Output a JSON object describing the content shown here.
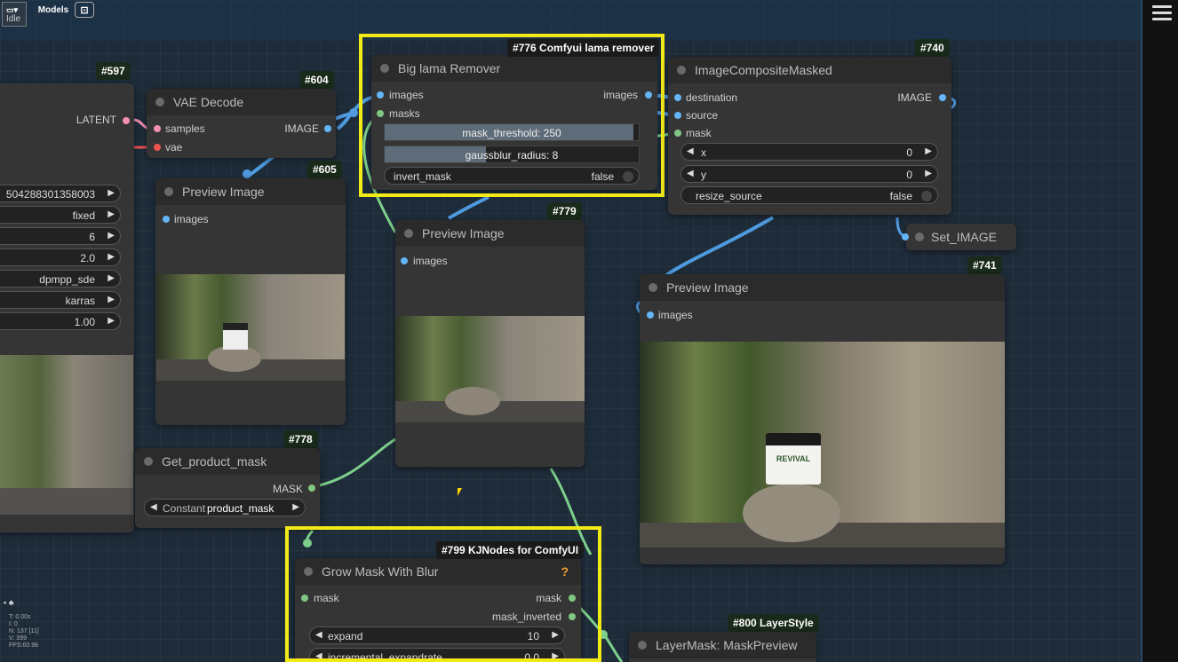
{
  "topbar": {
    "menu_label": "Idle",
    "models_label": "Models"
  },
  "nodes": {
    "n597": {
      "badge": "#597",
      "latent_label": "LATENT",
      "widgets": [
        "504288301358003",
        "fixed",
        "6",
        "2.0",
        "dpmpp_sde",
        "karras",
        "1.00"
      ]
    },
    "n604": {
      "badge": "#604",
      "title": "VAE Decode",
      "in1": "samples",
      "in2": "vae",
      "out1": "IMAGE"
    },
    "n605": {
      "badge": "#605",
      "title": "Preview Image",
      "in1": "images"
    },
    "n776": {
      "badge": "#776 Comfyui lama remover",
      "title": "Big lama Remover",
      "in1": "images",
      "in2": "masks",
      "out1": "images",
      "mask_threshold": "mask_threshold: 250",
      "mask_threshold_fill": 0.98,
      "gaussblur": "gaussblur_radius: 8",
      "gaussblur_fill": 0.4,
      "invert_label": "invert_mask",
      "invert_value": "false"
    },
    "n740": {
      "badge": "#740",
      "title": "ImageCompositeMasked",
      "in1": "destination",
      "in2": "source",
      "in3": "mask",
      "out1": "IMAGE",
      "x_label": "x",
      "x_value": "0",
      "y_label": "y",
      "y_value": "0",
      "resize_label": "resize_source",
      "resize_value": "false"
    },
    "set_image": {
      "title": "Set_IMAGE"
    },
    "n779": {
      "badge": "#779",
      "title": "Preview Image",
      "in1": "images"
    },
    "n741": {
      "badge": "#741",
      "title": "Preview Image",
      "in1": "images"
    },
    "n778": {
      "badge": "#778",
      "title": "Get_product_mask",
      "out1": "MASK",
      "select_prefix": "Constant",
      "select_value": "product_mask"
    },
    "n799": {
      "badge": "#799 KJNodes for ComfyUI",
      "title": "Grow Mask With Blur",
      "help": "?",
      "in1": "mask",
      "out1": "mask",
      "out2": "mask_inverted",
      "expand_label": "expand",
      "expand_value": "10",
      "incr_label": "incremental_expandrate",
      "incr_value": "0.0"
    },
    "n800": {
      "badge": "#800 LayerStyle",
      "title": "LayerMask: MaskPreview"
    }
  },
  "product_label": "REVIVAL",
  "stats": [
    "T: 0.00s",
    "I: 0",
    "N: 137 [11]",
    "V: 399",
    "FPS:60.98"
  ],
  "colors": {
    "highlight": "#f2ea17",
    "link_blue": "#4f9be0",
    "link_green": "#7ccf8a"
  },
  "icons": [
    "menu-icon",
    "upload-icon",
    "hamburger-icon"
  ]
}
